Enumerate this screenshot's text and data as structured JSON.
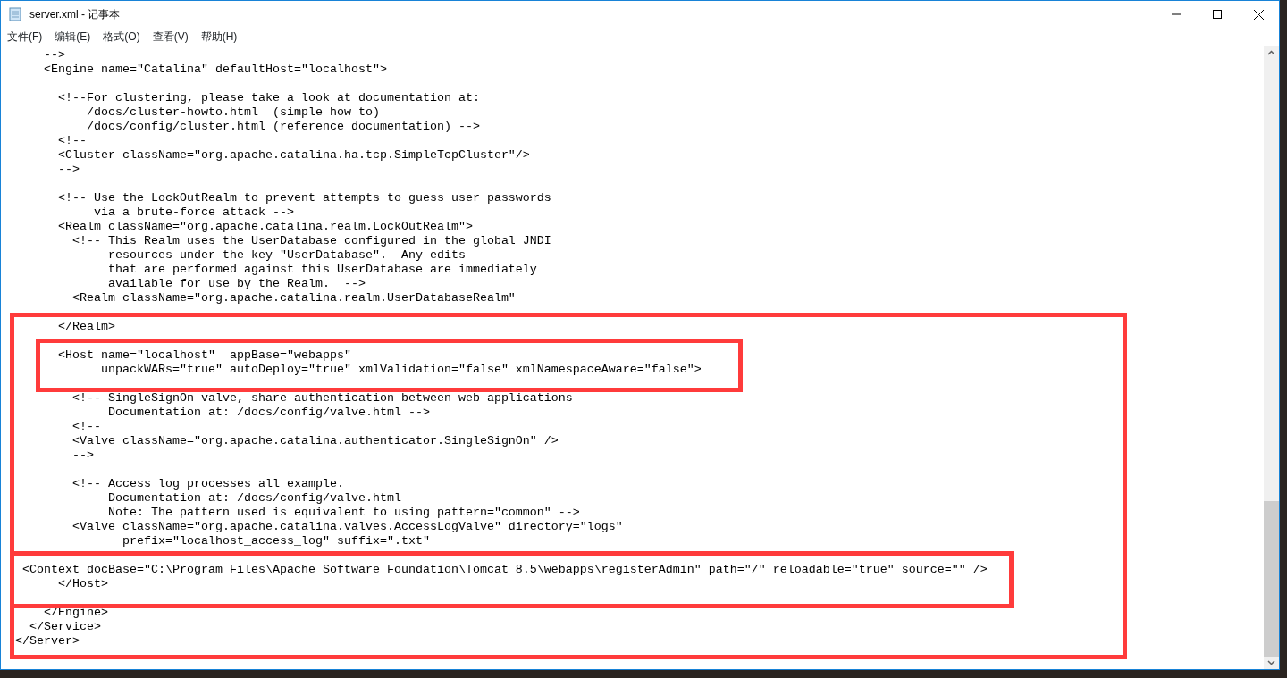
{
  "window": {
    "title": "server.xml - 记事本"
  },
  "menu": [
    {
      "label": "文件(F)"
    },
    {
      "label": "编辑(E)"
    },
    {
      "label": "格式(O)"
    },
    {
      "label": "查看(V)"
    },
    {
      "label": "帮助(H)"
    }
  ],
  "editor": {
    "lines": [
      {
        "kind": "text",
        "text": "    -->"
      },
      {
        "kind": "text",
        "text": "    <Engine name=\"Catalina\" defaultHost=\"localhost\">"
      },
      {
        "kind": "blank"
      },
      {
        "kind": "text",
        "text": "      <!--For clustering, please take a look at documentation at:"
      },
      {
        "kind": "text",
        "text": "          /docs/cluster-howto.html  (simple how to)"
      },
      {
        "kind": "text",
        "text": "          /docs/config/cluster.html (reference documentation) -->"
      },
      {
        "kind": "text",
        "text": "      <!--"
      },
      {
        "kind": "text",
        "text": "      <Cluster className=\"org.apache.catalina.ha.tcp.SimpleTcpCluster\"/>"
      },
      {
        "kind": "text",
        "text": "      -->"
      },
      {
        "kind": "blank"
      },
      {
        "kind": "text",
        "text": "      <!-- Use the LockOutRealm to prevent attempts to guess user passwords"
      },
      {
        "kind": "text",
        "text": "           via a brute-force attack -->"
      },
      {
        "kind": "text",
        "text": "      <Realm className=\"org.apache.catalina.realm.LockOutRealm\">"
      },
      {
        "kind": "text",
        "text": "        <!-- This Realm uses the UserDatabase configured in the global JNDI"
      },
      {
        "kind": "text",
        "text": "             resources under the key \"UserDatabase\".  Any edits"
      },
      {
        "kind": "text",
        "text": "             that are performed against this UserDatabase are immediately"
      },
      {
        "kind": "text",
        "text": "             available for use by the Realm.  -->"
      },
      {
        "kind": "text",
        "text": "        <Realm className=\"org.apache.catalina.realm.UserDatabaseRealm\""
      },
      {
        "kind": "blank"
      },
      {
        "kind": "text",
        "text": "      </Realm>"
      },
      {
        "kind": "blank"
      },
      {
        "kind": "text",
        "text": "      <Host name=\"localhost\"  appBase=\"webapps\""
      },
      {
        "kind": "text",
        "text": "            unpackWARs=\"true\" autoDeploy=\"true\" xmlValidation=\"false\" xmlNamespaceAware=\"false\">"
      },
      {
        "kind": "blank"
      },
      {
        "kind": "text",
        "text": "        <!-- SingleSignOn valve, share authentication between web applications"
      },
      {
        "kind": "text",
        "text": "             Documentation at: /docs/config/valve.html -->"
      },
      {
        "kind": "text",
        "text": "        <!--"
      },
      {
        "kind": "text",
        "text": "        <Valve className=\"org.apache.catalina.authenticator.SingleSignOn\" />"
      },
      {
        "kind": "text",
        "text": "        -->"
      },
      {
        "kind": "blank"
      },
      {
        "kind": "text",
        "text": "        <!-- Access log processes all example."
      },
      {
        "kind": "text",
        "text": "             Documentation at: /docs/config/valve.html"
      },
      {
        "kind": "text",
        "text": "             Note: The pattern used is equivalent to using pattern=\"common\" -->"
      },
      {
        "kind": "text",
        "text": "        <Valve className=\"org.apache.catalina.valves.AccessLogValve\" directory=\"logs\""
      },
      {
        "kind": "text",
        "text": "               prefix=\"localhost_access_log\" suffix=\".txt\""
      },
      {
        "kind": "blank"
      },
      {
        "kind": "text",
        "text": " <Context docBase=\"C:\\Program Files\\Apache Software Foundation\\Tomcat 8.5\\webapps\\registerAdmin\" path=\"/\" reloadable=\"true\" source=\"\" />"
      },
      {
        "kind": "text",
        "text": "      </Host>"
      },
      {
        "kind": "blank"
      },
      {
        "kind": "text",
        "text": "    </Engine>"
      },
      {
        "kind": "text",
        "text": "  </Service>"
      },
      {
        "kind": "text",
        "text": "</Server>"
      }
    ]
  },
  "annotation_boxes": [
    {
      "color": "#ff3b3b"
    },
    {
      "color": "#ff3b3b"
    },
    {
      "color": "#ff3b3b"
    }
  ]
}
